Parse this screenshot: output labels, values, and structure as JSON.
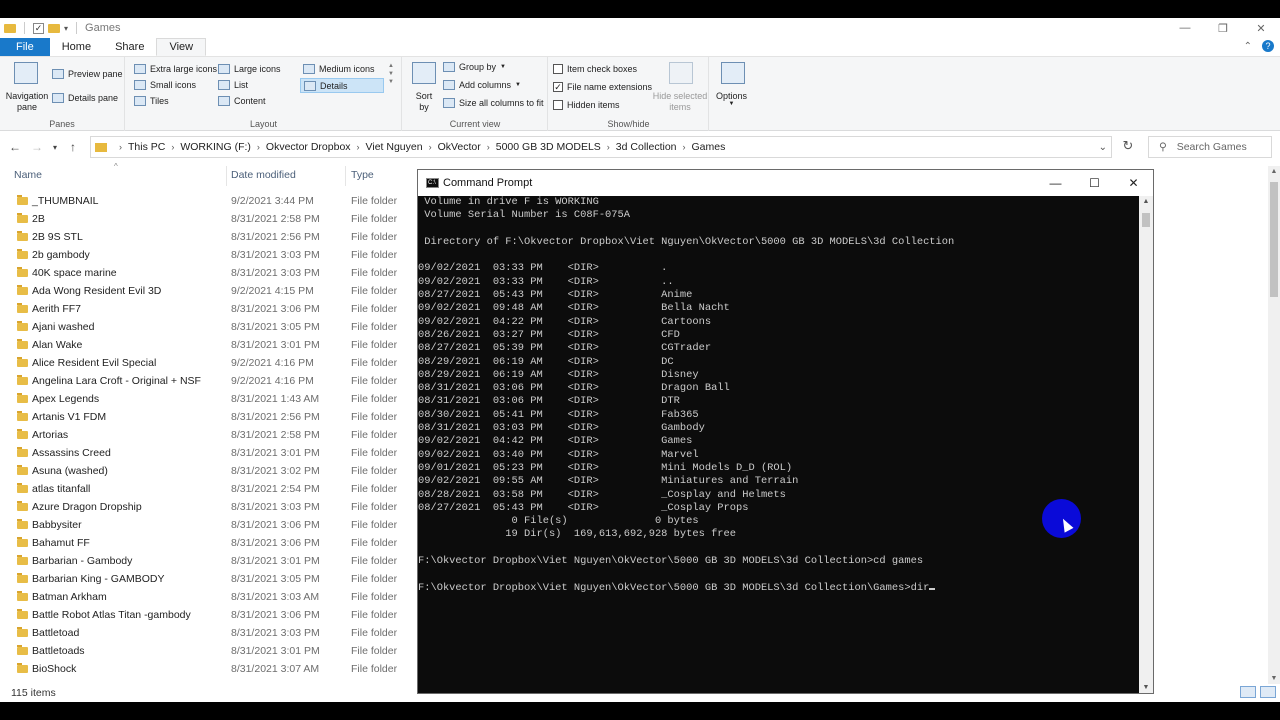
{
  "window": {
    "title": "Games",
    "controls": [
      "—",
      "❐",
      "✕"
    ]
  },
  "ribbon_tabs": [
    "File",
    "Home",
    "Share",
    "View"
  ],
  "ribbon": {
    "panes": {
      "navigation_pane": "Navigation pane",
      "preview_pane": "Preview pane",
      "details_pane": "Details pane",
      "label": "Panes"
    },
    "layout": {
      "items": [
        "Extra large icons",
        "Large icons",
        "Medium icons",
        "Small icons",
        "List",
        "Details",
        "Tiles",
        "Content"
      ],
      "selected": "Details",
      "label": "Layout"
    },
    "current_view": {
      "sort_by": "Sort by",
      "group_by": "Group by",
      "add_columns": "Add columns",
      "size_columns": "Size all columns to fit",
      "label": "Current view"
    },
    "show_hide": {
      "item_check_boxes": "Item check boxes",
      "file_name_extensions": "File name extensions",
      "hidden_items": "Hidden items",
      "hide_selected": "Hide selected items",
      "label": "Show/hide",
      "checked": {
        "item_check_boxes": false,
        "file_name_extensions": true,
        "hidden_items": false
      }
    },
    "options": "Options"
  },
  "address": {
    "crumbs": [
      "This PC",
      "WORKING (F:)",
      "Okvector Dropbox",
      "Viet Nguyen",
      "OkVector",
      "5000 GB 3D MODELS",
      "3d Collection",
      "Games"
    ],
    "search_placeholder": "Search Games"
  },
  "columns": {
    "name": "Name",
    "date": "Date modified",
    "type": "Type"
  },
  "files": [
    {
      "name": "_THUMBNAIL",
      "date": "9/2/2021 3:44 PM",
      "type": "File folder"
    },
    {
      "name": "2B",
      "date": "8/31/2021 2:58 PM",
      "type": "File folder"
    },
    {
      "name": "2B 9S STL",
      "date": "8/31/2021 2:56 PM",
      "type": "File folder"
    },
    {
      "name": "2b gambody",
      "date": "8/31/2021 3:03 PM",
      "type": "File folder"
    },
    {
      "name": "40K space marine",
      "date": "8/31/2021 3:03 PM",
      "type": "File folder"
    },
    {
      "name": "Ada Wong Resident Evil 3D",
      "date": "9/2/2021 4:15 PM",
      "type": "File folder"
    },
    {
      "name": "Aerith FF7",
      "date": "8/31/2021 3:06 PM",
      "type": "File folder"
    },
    {
      "name": "Ajani washed",
      "date": "8/31/2021 3:05 PM",
      "type": "File folder"
    },
    {
      "name": "Alan Wake",
      "date": "8/31/2021 3:01 PM",
      "type": "File folder"
    },
    {
      "name": "Alice Resident Evil Special",
      "date": "9/2/2021 4:16 PM",
      "type": "File folder"
    },
    {
      "name": "Angelina Lara Croft - Original + NSF",
      "date": "9/2/2021 4:16 PM",
      "type": "File folder"
    },
    {
      "name": "Apex Legends",
      "date": "8/31/2021 1:43 AM",
      "type": "File folder"
    },
    {
      "name": "Artanis V1 FDM",
      "date": "8/31/2021 2:56 PM",
      "type": "File folder"
    },
    {
      "name": "Artorias",
      "date": "8/31/2021 2:58 PM",
      "type": "File folder"
    },
    {
      "name": "Assassins Creed",
      "date": "8/31/2021 3:01 PM",
      "type": "File folder"
    },
    {
      "name": "Asuna (washed)",
      "date": "8/31/2021 3:02 PM",
      "type": "File folder"
    },
    {
      "name": "atlas titanfall",
      "date": "8/31/2021 2:54 PM",
      "type": "File folder"
    },
    {
      "name": "Azure Dragon Dropship",
      "date": "8/31/2021 3:03 PM",
      "type": "File folder"
    },
    {
      "name": "Babbysiter",
      "date": "8/31/2021 3:06 PM",
      "type": "File folder"
    },
    {
      "name": "Bahamut FF",
      "date": "8/31/2021 3:06 PM",
      "type": "File folder"
    },
    {
      "name": "Barbarian - Gambody",
      "date": "8/31/2021 3:01 PM",
      "type": "File folder"
    },
    {
      "name": "Barbarian King - GAMBODY",
      "date": "8/31/2021 3:05 PM",
      "type": "File folder"
    },
    {
      "name": "Batman Arkham",
      "date": "8/31/2021 3:03 AM",
      "type": "File folder"
    },
    {
      "name": "Battle Robot Atlas Titan -gambody",
      "date": "8/31/2021 3:06 PM",
      "type": "File folder"
    },
    {
      "name": "Battletoad",
      "date": "8/31/2021 3:03 PM",
      "type": "File folder"
    },
    {
      "name": "Battletoads",
      "date": "8/31/2021 3:01 PM",
      "type": "File folder"
    },
    {
      "name": "BioShock",
      "date": "8/31/2021 3:07 AM",
      "type": "File folder"
    }
  ],
  "status": "115 items",
  "cmd": {
    "title": "Command Prompt",
    "controls": [
      "—",
      "☐",
      "✕"
    ],
    "lines": [
      " Volume in drive F is WORKING",
      " Volume Serial Number is C08F-075A",
      "",
      " Directory of F:\\Okvector Dropbox\\Viet Nguyen\\OkVector\\5000 GB 3D MODELS\\3d Collection",
      "",
      "09/02/2021  03:33 PM    <DIR>          .",
      "09/02/2021  03:33 PM    <DIR>          ..",
      "08/27/2021  05:43 PM    <DIR>          Anime",
      "09/02/2021  09:48 AM    <DIR>          Bella Nacht",
      "09/02/2021  04:22 PM    <DIR>          Cartoons",
      "08/26/2021  03:27 PM    <DIR>          CFD",
      "08/27/2021  05:39 PM    <DIR>          CGTrader",
      "08/29/2021  06:19 AM    <DIR>          DC",
      "08/29/2021  06:19 AM    <DIR>          Disney",
      "08/31/2021  03:06 PM    <DIR>          Dragon Ball",
      "08/31/2021  03:06 PM    <DIR>          DTR",
      "08/30/2021  05:41 PM    <DIR>          Fab365",
      "08/31/2021  03:03 PM    <DIR>          Gambody",
      "09/02/2021  04:42 PM    <DIR>          Games",
      "09/02/2021  03:40 PM    <DIR>          Marvel",
      "09/01/2021  05:23 PM    <DIR>          Mini Models D_D (ROL)",
      "09/02/2021  09:55 AM    <DIR>          Miniatures and Terrain",
      "08/28/2021  03:58 PM    <DIR>          _Cosplay and Helmets",
      "08/27/2021  05:43 PM    <DIR>          _Cosplay Props",
      "               0 File(s)              0 bytes",
      "              19 Dir(s)  169,613,692,928 bytes free",
      "",
      "F:\\Okvector Dropbox\\Viet Nguyen\\OkVector\\5000 GB 3D MODELS\\3d Collection>cd games",
      "",
      "F:\\Okvector Dropbox\\Viet Nguyen\\OkVector\\5000 GB 3D MODELS\\3d Collection\\Games>dir"
    ]
  }
}
